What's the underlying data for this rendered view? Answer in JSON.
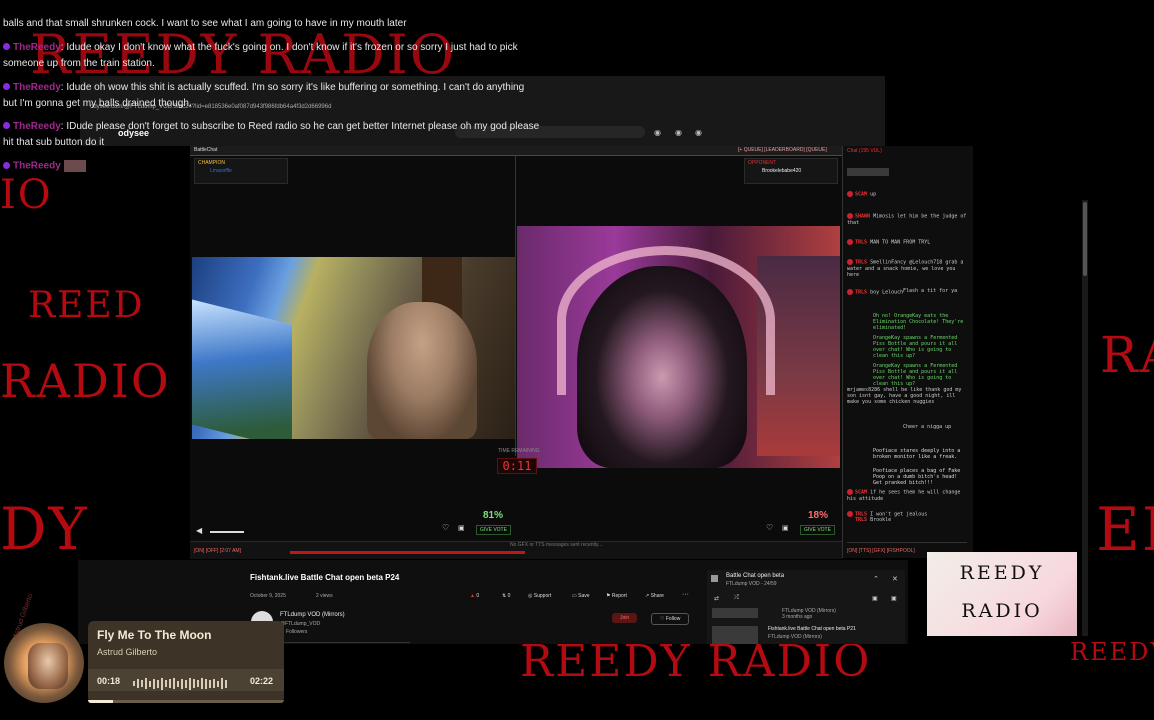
{
  "overlay_chat": [
    {
      "name": "",
      "text": "balls and that small shrunken cock. I want to see what I am going to have in my mouth later"
    },
    {
      "name": "TheReedy",
      "text": "Idude okay I don't know what the fuck's going on. I don't know if it's frozen or so sorry I just had to pick"
    },
    {
      "name": "",
      "text": "someone up from the train station."
    },
    {
      "name": "TheReedy",
      "text": "Idude oh wow this shit is actually scuffed. I'm so sorry it's like buffering or something. I can't do anything"
    },
    {
      "name": "",
      "text": "but I'm gonna get my balls drained though."
    },
    {
      "name": "TheReedy",
      "text": "IDude please don't forget to subscribe to Reed radio so he can get better Internet please oh my god please"
    },
    {
      "name": "",
      "text": "hit that sub button do it"
    },
    {
      "name": "TheReedy",
      "text": ""
    }
  ],
  "browser": {
    "url": "odysee.com/@FTLdump_VOD:9/bc24?lid=e818536e0af087d943f986fdb64a4f3d2d66996d"
  },
  "battle": {
    "app_name": "BattleChat",
    "top_links": "[+ QUEUE] [LEADERBOARD] [QUEUE]",
    "left_player": {
      "rank": "CHAMPION",
      "name": "Lmaooffle",
      "percent": "81%",
      "vote_label": "GIVE VOTE"
    },
    "right_player": {
      "rank": "OPPONENT",
      "name": "Brookelebabe420",
      "percent": "18%",
      "vote_label": "GIVE VOTE"
    },
    "timer_label": "TIME REMAINING",
    "timer": "0:11",
    "bottom_stats": "[ON] [OFF] [2:07 AM]",
    "bottom_note": "No GFX or TTS messages sent recently..."
  },
  "right_chat": {
    "tab": "Chat (195 VUL)",
    "messages": [
      {
        "name": "SCAM",
        "text": "up",
        "system": false
      },
      {
        "name": "SHAWN",
        "text": "Mimosis let him be the judge of that",
        "system": false
      },
      {
        "name": "TRLS",
        "text": "MAN TO MAN FROM TRYL",
        "system": false
      },
      {
        "name": "TRLS",
        "text": "SmellinFancy @Lelouch718 grab a water and a snack homie, we love you here",
        "system": false
      },
      {
        "name": "TRLS",
        "text": "boy Lelouch",
        "system": false
      },
      {
        "name": "",
        "text": "Flash a tit for ya",
        "system": false
      },
      {
        "name": "",
        "text": "Oh no! OrangeKay eats the Elimination Chocolate! They're eliminated!",
        "system": true
      },
      {
        "name": "",
        "text": "OrangeKay spawns a Fermented Piss Bottle and pours it all over chat! Who is going to clean this up?",
        "system": true
      },
      {
        "name": "",
        "text": "OrangeKay spawns a Fermented Piss Bottle and pours it all over chat! Who is going to clean this up?",
        "system": true
      },
      {
        "name": "",
        "text": "mrjames8286 shell be like thank god my son isnt gay, have a good night, ill make you some chicken nuggies",
        "system": false
      },
      {
        "name": "",
        "text": "Cheer a nigga up",
        "system": false
      },
      {
        "name": "",
        "text": "Poofiace stares deeply into a broken monitor like a freak.",
        "system": true
      },
      {
        "name": "",
        "text": "Poofiace places a bag of Fake Poop on a dumb bitch's head! Get pranked bitch!!!",
        "system": true
      },
      {
        "name": "SCAM",
        "text": "if he sees them he will change his attitude",
        "system": false
      },
      {
        "name": "TRLS",
        "text": "I won't get jealous",
        "system": false
      },
      {
        "name": "TRLS",
        "text": "Brookle",
        "system": false
      }
    ],
    "footer": "[ON] [TTS] [GFX] [FISHPOOL]"
  },
  "youtube": {
    "title": "Fishtank.live Battle Chat open beta P24",
    "date": "October 9, 2025",
    "views": "2 views",
    "channel": "FTLdump VOD (Mirrors)",
    "channel_handle": "@FTLdump_VOD",
    "followers": "Followers",
    "likes": "0",
    "reposts": "0",
    "support": "Support",
    "save": "Save",
    "report": "Report",
    "share": "Share",
    "join": "Join",
    "follow": "Follow",
    "side_title": "Battle Chat open beta",
    "side_sub": "FTLdump VOD - 24/59",
    "side_item_1_channel": "FTLdump VOD (Mirrors)",
    "side_item_1_meta": "3 months ago",
    "side_item_2_title": "Fishtank.live Battle Chat open beta P21",
    "side_item_2_channel": "FTLdump VOD (Mirrors)"
  },
  "music": {
    "title": "Fly Me To The Moon",
    "artist": "Astrud Gilberto",
    "elapsed": "00:18",
    "duration": "02:22",
    "progress": 0.13,
    "album_caption": "Astrud Gilberto"
  },
  "logo": {
    "line1": "REEDY",
    "line2": "RADIO"
  },
  "background_text": {
    "top": "REEDY RADIO",
    "left1": "REED",
    "left2": "RADIO",
    "left3": "DY",
    "bottom": "REEDY RADIO",
    "bottom_right": "REEDY",
    "right1": "RA",
    "right2": "ED"
  },
  "colors": {
    "accent_red": "#b40a12",
    "vote_green": "#7be37b",
    "music_bg": "#3d3326"
  }
}
